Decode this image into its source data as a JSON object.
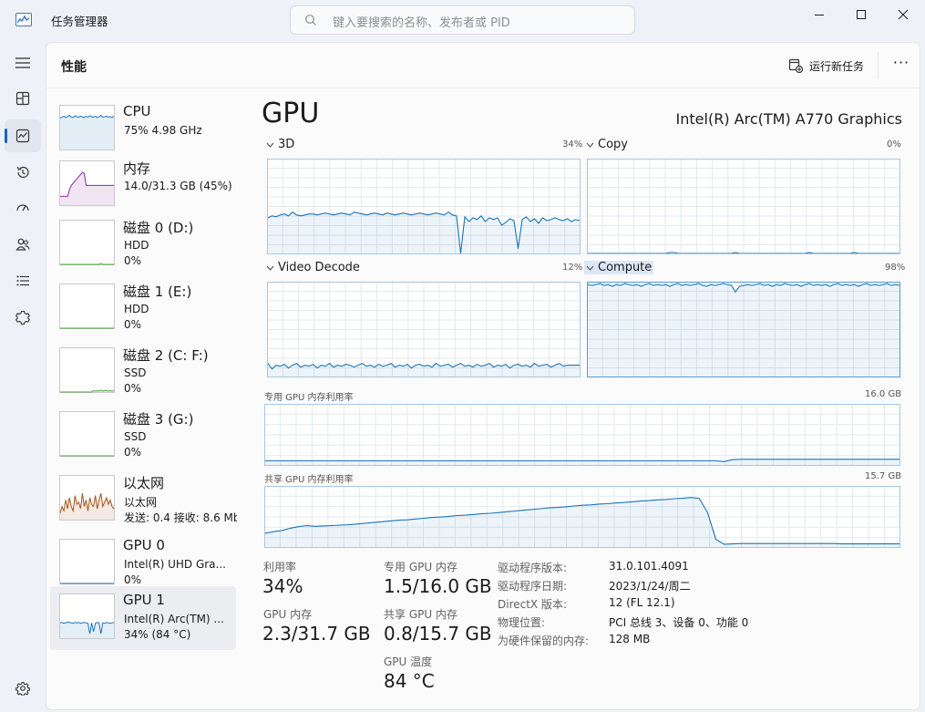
{
  "window": {
    "title": "任务管理器",
    "search_placeholder": "键入要搜索的名称、发布者或 PID"
  },
  "nav": {
    "items": [
      "menu-icon",
      "processes-icon",
      "performance-icon",
      "app-history-icon",
      "startup-icon",
      "users-icon",
      "details-icon",
      "services-icon",
      "settings-icon"
    ],
    "active": "performance-icon"
  },
  "header": {
    "title": "性能",
    "run_task_label": "运行新任务",
    "more_label": "···"
  },
  "devices": [
    {
      "name": "CPU",
      "line1": "75% 4.98 GHz",
      "line2": "",
      "color": "#1a74b6",
      "values": [
        0.72,
        0.74,
        0.76,
        0.73,
        0.75,
        0.78,
        0.74,
        0.73,
        0.77,
        0.75,
        0.74,
        0.76,
        0.75,
        0.73,
        0.76,
        0.74,
        0.77,
        0.75,
        0.74,
        0.76,
        0.73,
        0.75,
        0.78,
        0.74,
        0.75,
        0.76,
        0.74,
        0.75,
        0.73,
        0.76
      ]
    },
    {
      "name": "内存",
      "line1": "14.0/31.3 GB (45%)",
      "line2": "",
      "color": "#8b2aa7",
      "values": [
        0.2,
        0.2,
        0.2,
        0.2,
        0.2,
        0.35,
        0.45,
        0.5,
        0.55,
        0.6,
        0.65,
        0.7,
        0.75,
        0.72,
        0.45,
        0.45,
        0.45,
        0.45,
        0.45,
        0.45,
        0.45,
        0.45,
        0.45,
        0.45,
        0.45,
        0.45,
        0.45,
        0.45,
        0.45,
        0.45
      ]
    },
    {
      "name": "磁盘 0 (D:)",
      "line1": "HDD",
      "line2": "0%",
      "color": "#4ea53e",
      "values": [
        0,
        0,
        0,
        0,
        0,
        0,
        0,
        0,
        0,
        0,
        0,
        0,
        0,
        0,
        0,
        0,
        0,
        0,
        0,
        0,
        0,
        0,
        0.02,
        0,
        0,
        0,
        0,
        0,
        0,
        0
      ]
    },
    {
      "name": "磁盘 1 (E:)",
      "line1": "HDD",
      "line2": "0%",
      "color": "#4ea53e",
      "values": [
        0,
        0,
        0,
        0,
        0,
        0,
        0,
        0,
        0,
        0,
        0,
        0,
        0,
        0,
        0,
        0,
        0,
        0,
        0,
        0,
        0,
        0,
        0,
        0,
        0,
        0,
        0,
        0,
        0,
        0
      ]
    },
    {
      "name": "磁盘 2 (C: F:)",
      "line1": "SSD",
      "line2": "0%",
      "color": "#4ea53e",
      "values": [
        0,
        0,
        0,
        0,
        0,
        0,
        0,
        0,
        0,
        0,
        0,
        0,
        0,
        0,
        0,
        0,
        0,
        0,
        0.03,
        0.02,
        0.03,
        0.02,
        0.04,
        0.02,
        0.03,
        0.03,
        0.02,
        0.03,
        0.02,
        0.03
      ]
    },
    {
      "name": "磁盘 3 (G:)",
      "line1": "SSD",
      "line2": "0%",
      "color": "#4ea53e",
      "values": [
        0,
        0,
        0,
        0,
        0,
        0,
        0,
        0,
        0,
        0,
        0,
        0,
        0,
        0,
        0,
        0,
        0,
        0,
        0,
        0,
        0,
        0,
        0,
        0,
        0,
        0,
        0,
        0,
        0,
        0
      ]
    },
    {
      "name": "以太网",
      "line1": "以太网",
      "line2": "发送: 0.4 接收: 8.6 Mb",
      "color": "#a5541a",
      "values": [
        0.15,
        0.3,
        0.2,
        0.45,
        0.25,
        0.5,
        0.3,
        0.2,
        0.55,
        0.35,
        0.4,
        0.25,
        0.6,
        0.3,
        0.45,
        0.2,
        0.5,
        0.35,
        0.3,
        0.55,
        0.25,
        0.45,
        0.6,
        0.3,
        0.4,
        0.5,
        0.35,
        0.45,
        0.3,
        0.25
      ]
    },
    {
      "name": "GPU 0",
      "line1": "Intel(R) UHD Gra...",
      "line2": "0%",
      "color": "#1a74b6",
      "values": [
        0,
        0,
        0,
        0,
        0,
        0,
        0,
        0,
        0,
        0,
        0,
        0,
        0,
        0,
        0,
        0,
        0,
        0,
        0,
        0,
        0,
        0,
        0,
        0,
        0,
        0,
        0,
        0,
        0,
        0
      ]
    },
    {
      "name": "GPU 1",
      "line1": "Intel(R) Arc(TM) ...",
      "line2": "34% (84 °C)",
      "color": "#1a74b6",
      "values": [
        0.35,
        0.36,
        0.34,
        0.35,
        0.37,
        0.36,
        0.35,
        0.34,
        0.36,
        0.35,
        0.36,
        0.34,
        0.35,
        0.36,
        0.35,
        0.34,
        0.1,
        0.35,
        0.15,
        0.34,
        0.36,
        0.35,
        0.1,
        0.35,
        0.34,
        0.36,
        0.35,
        0.34,
        0.35,
        0.36
      ]
    }
  ],
  "gpu": {
    "title": "GPU",
    "model": "Intel(R) Arc(TM) A770 Graphics",
    "engines": [
      {
        "label": "3D",
        "pct": "34%"
      },
      {
        "label": "Copy",
        "pct": "0%"
      },
      {
        "label": "Video Decode",
        "pct": "12%"
      },
      {
        "label": "Compute",
        "pct": "98%"
      }
    ],
    "dedicated_label": "专用 GPU 内存利用率",
    "dedicated_max": "16.0 GB",
    "shared_label": "共享 GPU 内存利用率",
    "shared_max": "15.7 GB",
    "stats": {
      "util_label": "利用率",
      "util_value": "34%",
      "dedicated_label": "专用 GPU 内存",
      "dedicated_value": "1.5/16.0 GB",
      "gpumem_label": "GPU 内存",
      "gpumem_value": "2.3/31.7 GB",
      "shared_label": "共享 GPU 内存",
      "shared_value": "0.8/15.7 GB",
      "temp_label": "GPU 温度",
      "temp_value": "84 °C"
    },
    "info": [
      {
        "k": "驱动程序版本:",
        "v": "31.0.101.4091"
      },
      {
        "k": "驱动程序日期:",
        "v": "2023/1/24/周二"
      },
      {
        "k": "DirectX 版本:",
        "v": "12 (FL 12.1)"
      },
      {
        "k": "物理位置:",
        "v": "PCI 总线 3、设备 0、功能 0"
      },
      {
        "k": "为硬件保留的内存:",
        "v": "128 MB"
      }
    ]
  },
  "chart_data": [
    {
      "type": "line",
      "title": "3D",
      "ylim": [
        0,
        100
      ],
      "grid": true,
      "series": [
        {
          "values": [
            38,
            40,
            39,
            41,
            42,
            40,
            44,
            41,
            40,
            41,
            42,
            42,
            41,
            42,
            43,
            42,
            41,
            42,
            43,
            42,
            41,
            44,
            43,
            42,
            41,
            42,
            43,
            42,
            41,
            43,
            42,
            41,
            42,
            43,
            42,
            41,
            42,
            43,
            42,
            41,
            42,
            43,
            42,
            41,
            44,
            41,
            40,
            0,
            39,
            34,
            38,
            36,
            40,
            34,
            38,
            36,
            38,
            30,
            33,
            37,
            35,
            5,
            36,
            39,
            34,
            37,
            32,
            38,
            35,
            36,
            38,
            36,
            35,
            37,
            34,
            36,
            35
          ]
        }
      ]
    },
    {
      "type": "line",
      "title": "Copy",
      "ylim": [
        0,
        100
      ],
      "grid": true,
      "series": [
        {
          "values": [
            0,
            0,
            0,
            0,
            0,
            0,
            0,
            0,
            0,
            0,
            0,
            0,
            0,
            0,
            0,
            0,
            0,
            0,
            0,
            0,
            1,
            1,
            0,
            0,
            0,
            0,
            0,
            0,
            0,
            0,
            0,
            0,
            0,
            0,
            0,
            0,
            1,
            0,
            0,
            0,
            0,
            0,
            0,
            0,
            0,
            0,
            0,
            0,
            0,
            0,
            0,
            0,
            0,
            0,
            1,
            0,
            0,
            0,
            0,
            0,
            0,
            0,
            0,
            0,
            0,
            1,
            0,
            0,
            0,
            0,
            0,
            0,
            0,
            0,
            0,
            0,
            0
          ]
        }
      ]
    },
    {
      "type": "line",
      "title": "Video Decode",
      "ylim": [
        0,
        100
      ],
      "grid": true,
      "series": [
        {
          "values": [
            14,
            8,
            12,
            11,
            13,
            9,
            12,
            14,
            10,
            12,
            11,
            13,
            9,
            12,
            11,
            14,
            10,
            12,
            11,
            13,
            12,
            10,
            12,
            14,
            11,
            12,
            10,
            13,
            11,
            12,
            14,
            10,
            12,
            11,
            13,
            9,
            12,
            13,
            11,
            12,
            10,
            14,
            11,
            12,
            13,
            10,
            12,
            14,
            11,
            12,
            10,
            13,
            11,
            12,
            14,
            10,
            12,
            11,
            13,
            9,
            12,
            13,
            11,
            12,
            10,
            14,
            11,
            12,
            13,
            10,
            12,
            14,
            11,
            12,
            12,
            12,
            12
          ]
        }
      ]
    },
    {
      "type": "line",
      "title": "Compute",
      "ylim": [
        0,
        100
      ],
      "grid": true,
      "series": [
        {
          "values": [
            98,
            97,
            98,
            99,
            97,
            98,
            96,
            98,
            97,
            99,
            98,
            97,
            98,
            96,
            98,
            99,
            97,
            98,
            97,
            98,
            96,
            98,
            99,
            97,
            98,
            97,
            98,
            99,
            97,
            96,
            98,
            97,
            98,
            99,
            98,
            97,
            90,
            96,
            97,
            98,
            97,
            98,
            99,
            97,
            98,
            96,
            98,
            97,
            99,
            98,
            97,
            98,
            96,
            98,
            99,
            97,
            98,
            97,
            98,
            96,
            98,
            99,
            97,
            98,
            97,
            98,
            96,
            98,
            99,
            97,
            98,
            97,
            98,
            99,
            97,
            98,
            97
          ]
        }
      ]
    },
    {
      "type": "line",
      "title": "专用 GPU 内存利用率",
      "ylim": [
        0,
        16
      ],
      "grid": true,
      "series": [
        {
          "values": [
            1.1,
            1.1,
            1.1,
            1.1,
            1.1,
            1.1,
            1.1,
            1.1,
            1.1,
            1.1,
            1.1,
            1.1,
            1.1,
            1.1,
            1.1,
            1.1,
            1.1,
            1.1,
            1.1,
            1.1,
            1.1,
            1.1,
            1.1,
            1.1,
            1.1,
            1.1,
            1.1,
            1.1,
            1.1,
            1.1,
            1.1,
            1.1,
            1.1,
            1.1,
            1.1,
            1.1,
            1.1,
            1.1,
            1.1,
            1.1,
            1.1,
            1.1,
            1.1,
            1.1,
            1.1,
            1.1,
            1.1,
            1.1,
            1.1,
            1.1,
            1.1,
            1.1,
            1.1,
            1.1,
            1.1,
            0.9,
            1.4,
            1.5,
            1.5,
            1.5,
            1.5,
            1.5,
            1.5,
            1.5,
            1.5,
            1.5,
            1.5,
            1.5,
            1.5,
            1.5,
            1.5,
            1.5,
            1.5,
            1.5,
            1.5,
            1.5,
            1.5
          ]
        }
      ]
    },
    {
      "type": "area",
      "title": "共享 GPU 内存利用率",
      "ylim": [
        0,
        15.7
      ],
      "grid": true,
      "series": [
        {
          "values": [
            3.6,
            4.0,
            4.3,
            4.9,
            5.3,
            5.6,
            5.4,
            5.5,
            5.6,
            5.7,
            5.8,
            6.0,
            6.2,
            6.4,
            6.6,
            6.8,
            7.0,
            7.1,
            7.3,
            7.5,
            7.7,
            7.8,
            8.0,
            8.2,
            8.3,
            8.5,
            8.7,
            8.8,
            9.0,
            9.2,
            9.4,
            9.6,
            9.8,
            10.0,
            10.2,
            10.3,
            10.5,
            10.7,
            10.9,
            11.0,
            11.2,
            11.3,
            11.5,
            11.6,
            11.8,
            12.0,
            12.1,
            12.3,
            12.4,
            12.6,
            12.7,
            12.9,
            12.7,
            9.0,
            2.0,
            0.7,
            0.8,
            0.9,
            0.9,
            0.9,
            0.9,
            0.9,
            0.9,
            0.9,
            0.9,
            0.9,
            0.9,
            0.9,
            0.9,
            0.8,
            0.8,
            0.8,
            0.8,
            0.8,
            0.8,
            0.8,
            0.8
          ]
        }
      ]
    }
  ]
}
